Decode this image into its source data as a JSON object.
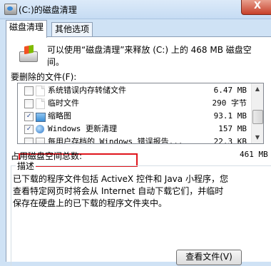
{
  "window": {
    "title": "(C:)的磁盘清理",
    "close_label": "X"
  },
  "tabs": [
    {
      "label": "磁盘清理"
    },
    {
      "label": "其他选项"
    }
  ],
  "summary": "可以使用“磁盘清理”来释放  (C:) 上的 468 MB 磁盘空间。",
  "list": {
    "label": "要删除的文件(F):",
    "items": [
      {
        "name": "系统错误内存转储文件",
        "size": "6.47 MB",
        "checked": false,
        "icon": "blank-file-icon"
      },
      {
        "name": "临时文件",
        "size": "290 字节",
        "checked": false,
        "icon": "blank-file-icon"
      },
      {
        "name": "缩略图",
        "size": "93.1 MB",
        "checked": true,
        "icon": "thumbnail-icon"
      },
      {
        "name": "Windows 更新清理",
        "size": "157 MB",
        "checked": true,
        "icon": "update-icon"
      },
      {
        "name": "每用户存档的 Windows 错误报告...",
        "size": "22.3 KB",
        "checked": false,
        "icon": "report-icon"
      }
    ]
  },
  "total": {
    "label": "占用磁盘空间总数:",
    "value": "461 MB"
  },
  "description": {
    "title": "描述",
    "text": "已下载的程序文件包括 ActiveX 控件和 Java 小程序，您\n查看特定网页时将会从 Internet 自动下载它们，并临时\n保存在硬盘上的已下载的程序文件夹中。"
  },
  "buttons": {
    "view_files": "查看文件(V)"
  },
  "colors": {
    "highlight_border": "#e0151c",
    "window_frame": "#cfe2f5"
  }
}
